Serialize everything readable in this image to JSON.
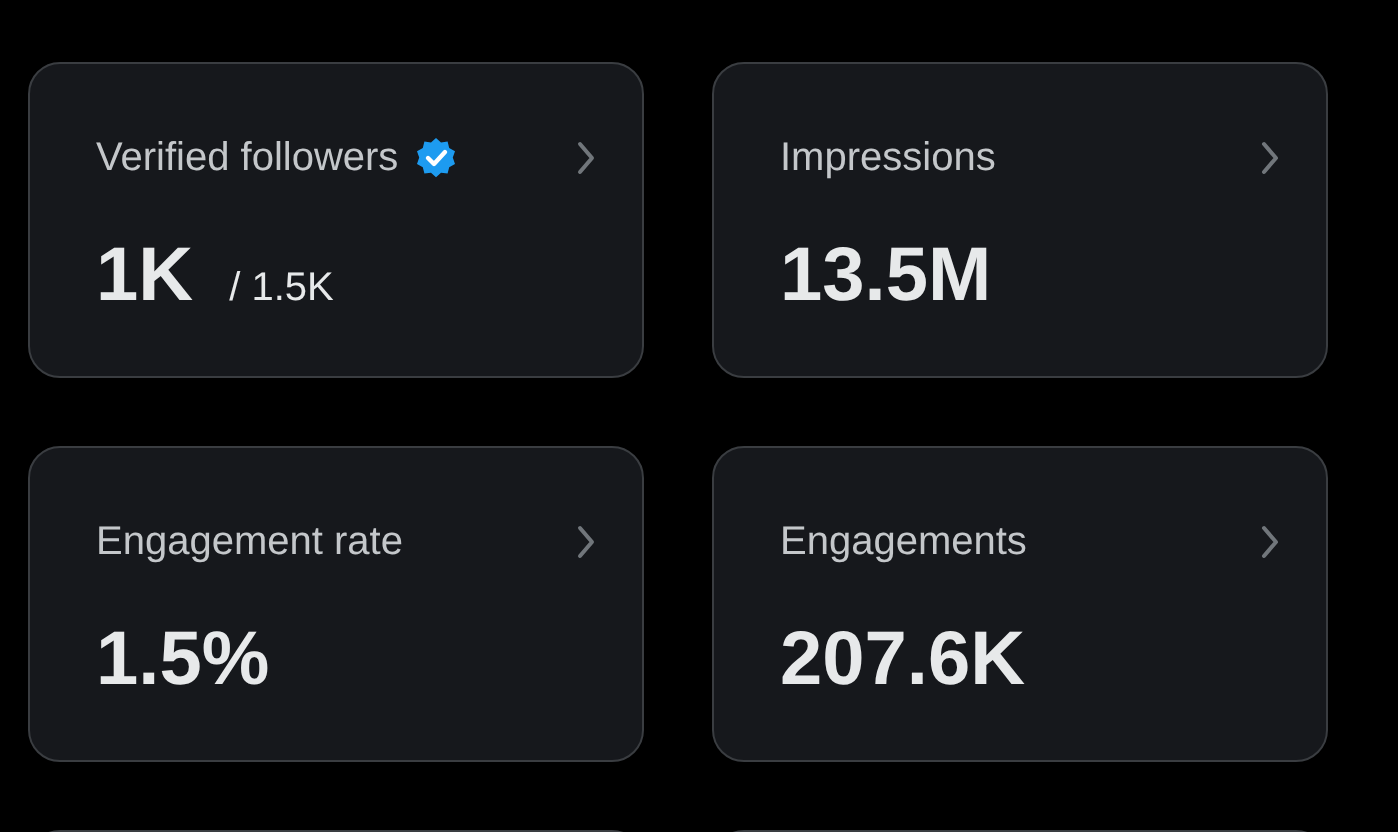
{
  "cards": [
    {
      "title": "Verified followers",
      "verified": true,
      "value": "1K",
      "total": "/ 1.5K"
    },
    {
      "title": "Impressions",
      "verified": false,
      "value": "13.5M"
    },
    {
      "title": "Engagement rate",
      "verified": false,
      "value": "1.5%"
    },
    {
      "title": "Engagements",
      "verified": false,
      "value": "207.6K"
    }
  ]
}
